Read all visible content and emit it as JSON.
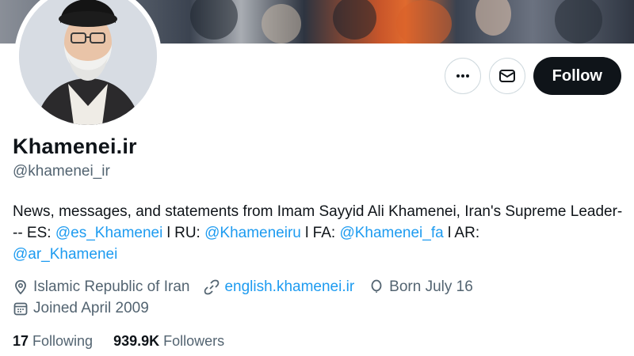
{
  "header": {
    "name": "Khamenei.ir",
    "handle": "@khamenei_ir"
  },
  "actions": {
    "more_icon": "ellipsis-icon",
    "message_icon": "envelope-icon",
    "follow_label": "Follow"
  },
  "bio": {
    "line1_text": "News, messages, and statements from Imam Sayyid Ali Khamenei, Iran's Supreme Leader--- ES: ",
    "mention_es": "@es_Khamenei",
    "sep_ru": " l RU: ",
    "mention_ru": "@Khameneiru",
    "sep_fa": " l FA: ",
    "mention_fa": "@Khamenei_fa",
    "sep_ar": " l AR: ",
    "mention_ar": "@ar_Khamenei"
  },
  "meta": {
    "location": "Islamic Republic of Iran",
    "website": "english.khamenei.ir",
    "birthday": "Born July 16",
    "joined": "Joined April 2009"
  },
  "stats": {
    "following_count": "17",
    "following_label": "Following",
    "followers_count": "939.9K",
    "followers_label": "Followers"
  },
  "colors": {
    "link": "#1d9bf0",
    "secondary_text": "#536471",
    "primary_text": "#0f1419",
    "follow_bg": "#0f1419"
  }
}
